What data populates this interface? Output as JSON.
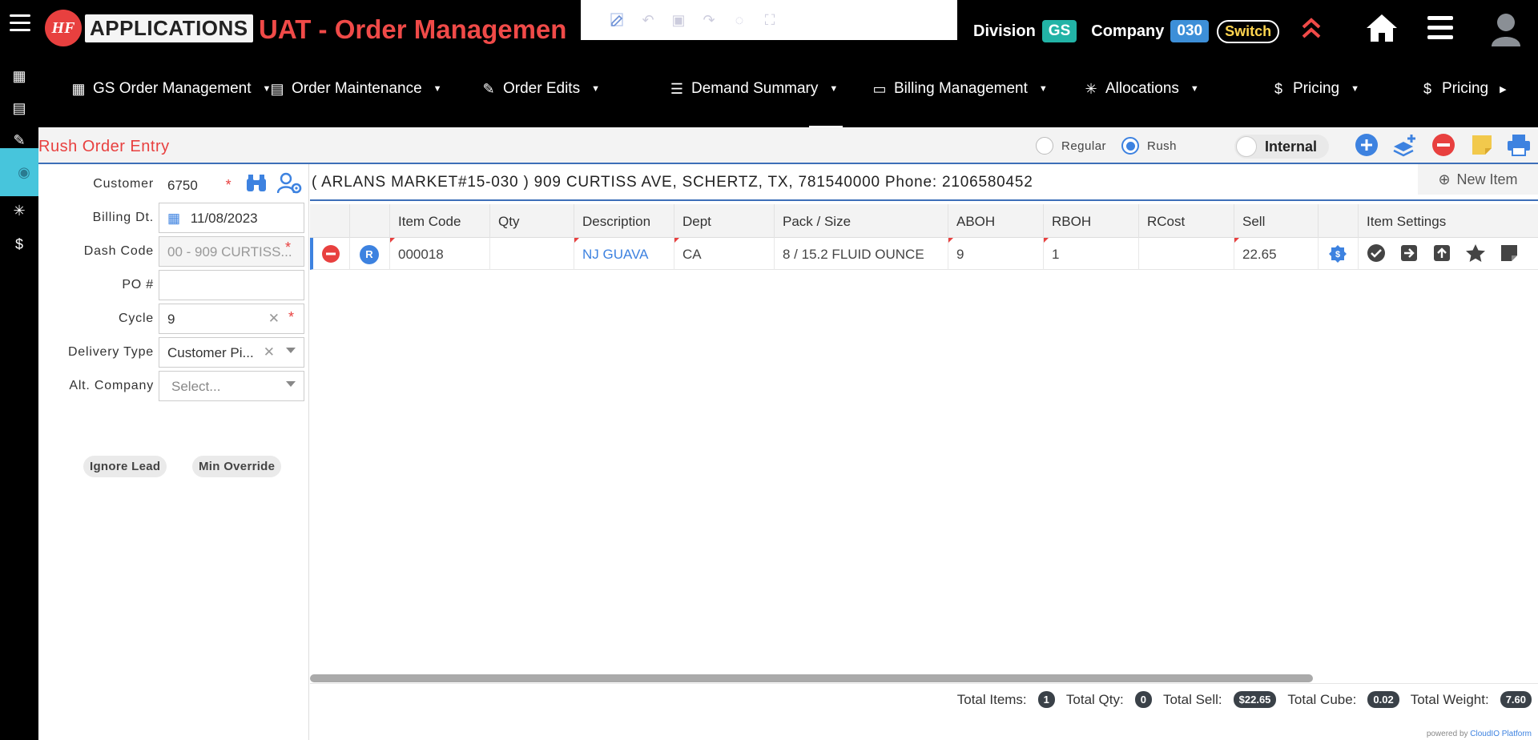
{
  "header": {
    "logo_initials": "HF",
    "logo_text": "APPLICATIONS",
    "app_title": "UAT - Order Managemen",
    "division_label": "Division",
    "division_value": "GS",
    "company_label": "Company",
    "company_value": "030",
    "switch_label": "Switch",
    "colors": {
      "title": "#f04a48",
      "division_badge": "#22b3a6",
      "company_badge": "#3d8fd8",
      "switch_text": "#ffd54f"
    }
  },
  "nav": {
    "items": [
      {
        "label": "GS Order Management",
        "icon": "grid-icon"
      },
      {
        "label": "Order Maintenance",
        "icon": "list-doc-icon"
      },
      {
        "label": "Order Edits",
        "icon": "edit-icon"
      },
      {
        "label": "Demand Summary",
        "icon": "bars-icon"
      },
      {
        "label": "Billing Management",
        "icon": "id-card-icon"
      },
      {
        "label": "Allocations",
        "icon": "asterisk-icon"
      },
      {
        "label": "Pricing",
        "icon": "dollar-circle-icon"
      },
      {
        "label": "Pricing",
        "icon": "dollar-circle-icon"
      }
    ]
  },
  "page": {
    "title": "Rush Order Entry",
    "order_type": {
      "regular": "Regular",
      "rush": "Rush",
      "selected": "Rush"
    },
    "internal_label": "Internal"
  },
  "form": {
    "customer": {
      "label": "Customer",
      "value": "6750"
    },
    "billing_date": {
      "label": "Billing Dt.",
      "value": "11/08/2023"
    },
    "dash_code": {
      "label": "Dash Code",
      "value": "00 - 909 CURTISS..."
    },
    "po": {
      "label": "PO #",
      "value": ""
    },
    "cycle": {
      "label": "Cycle",
      "value": "9"
    },
    "delivery_type": {
      "label": "Delivery Type",
      "value": "Customer Pi..."
    },
    "alt_company": {
      "label": "Alt. Company",
      "placeholder": "Select..."
    },
    "ignore_lead": "Ignore Lead",
    "min_override": "Min Override"
  },
  "grid": {
    "address": "( ARLANS MARKET#15-030 ) 909 CURTISS AVE, SCHERTZ, TX, 781540000 Phone: 2106580452",
    "new_item": "New Item",
    "columns": [
      "Item Code",
      "Qty",
      "Description",
      "Dept",
      "Pack / Size",
      "ABOH",
      "RBOH",
      "RCost",
      "Sell",
      "Item Settings"
    ],
    "rows": [
      {
        "status": "R",
        "item_code": "000018",
        "qty": "",
        "description": "NJ GUAVA",
        "dept": "CA",
        "pack_size": "8 / 15.2 FLUID OUNCE",
        "aboh": "9",
        "rboh": "1",
        "rcost": "",
        "sell": "22.65"
      }
    ]
  },
  "footer": {
    "total_items_label": "Total Items:",
    "total_items": "1",
    "total_qty_label": "Total Qty:",
    "total_qty": "0",
    "total_sell_label": "Total Sell:",
    "total_sell": "$22.65",
    "total_cube_label": "Total Cube:",
    "total_cube": "0.02",
    "total_weight_label": "Total Weight:",
    "total_weight": "7.60",
    "powered_prefix": "powered by",
    "powered_brand": "CloudIO Platform"
  }
}
